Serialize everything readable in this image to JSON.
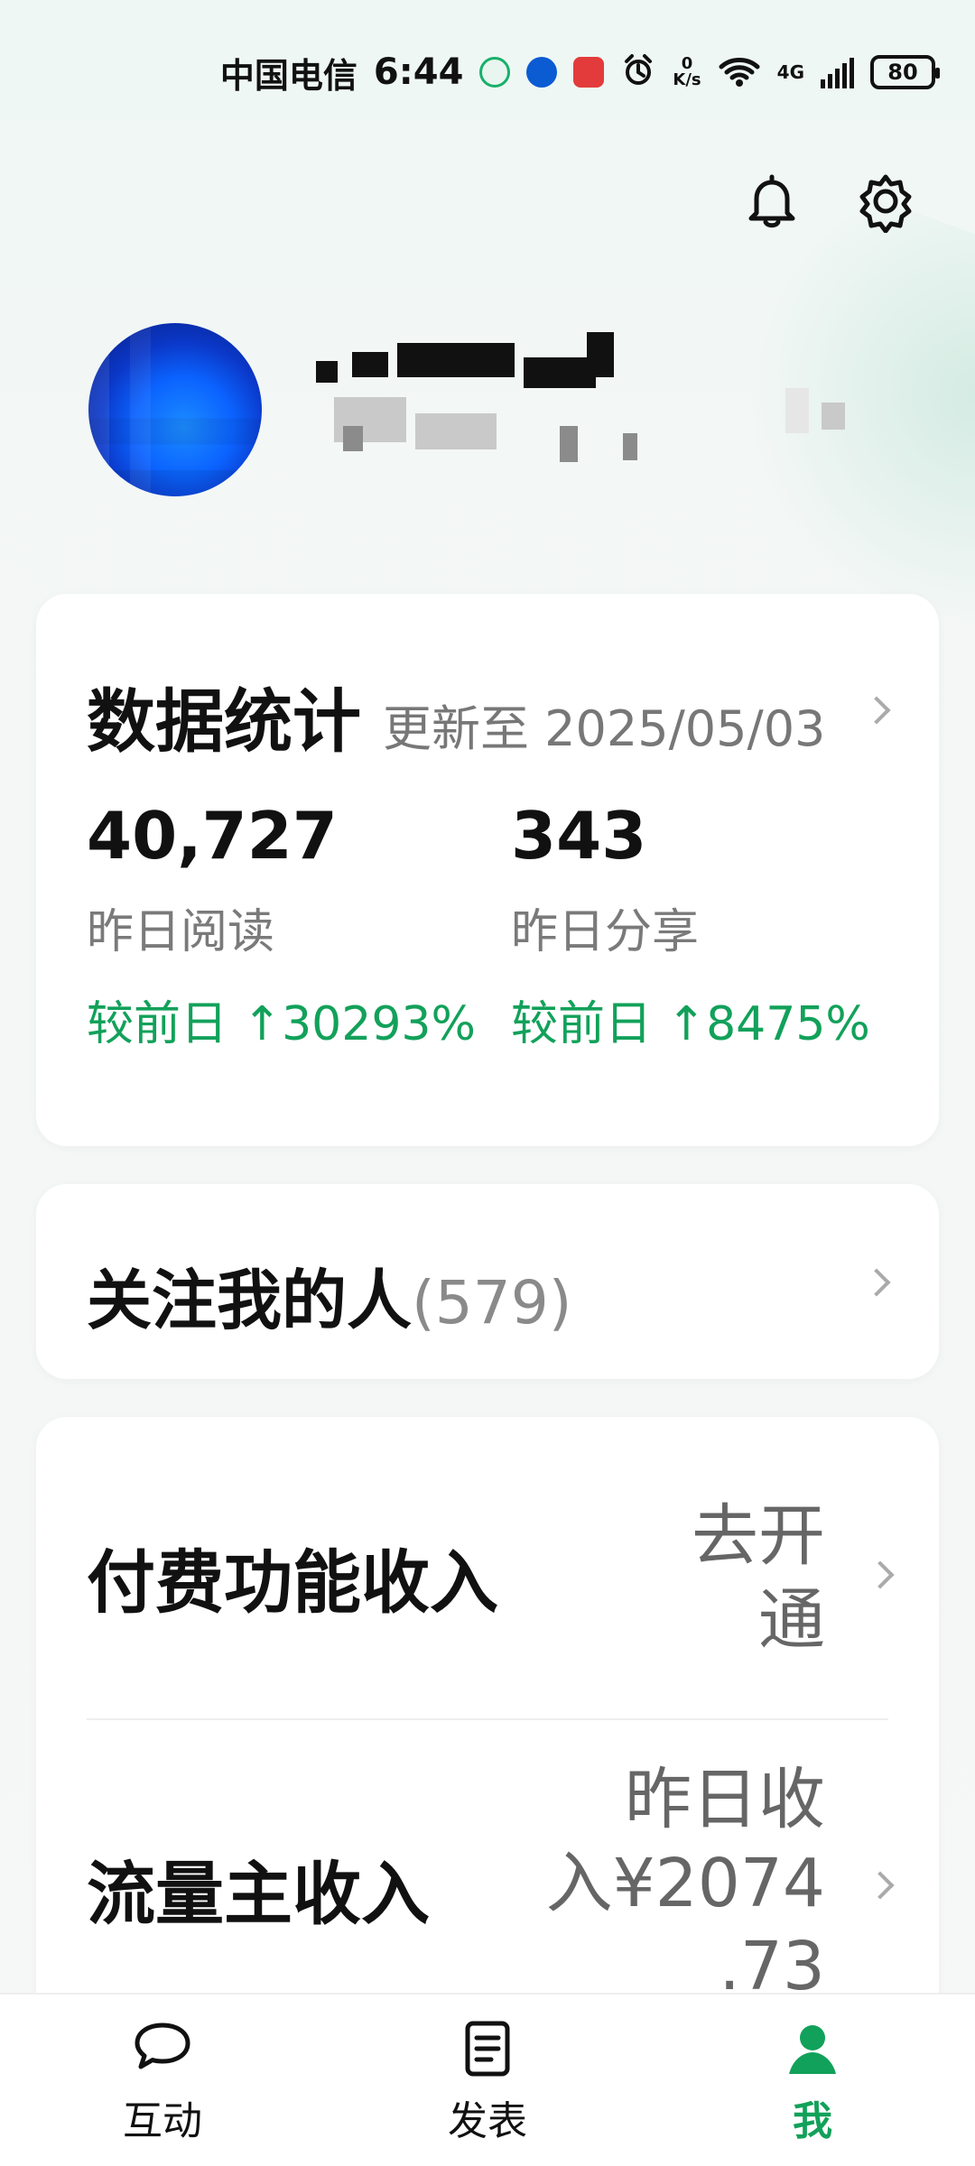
{
  "status_bar": {
    "carrier": "中国电信",
    "time": "6:44",
    "net_speed_value": "0",
    "net_speed_unit": "K/s",
    "network": "4G",
    "battery": "80"
  },
  "header": {
    "icons": [
      "bell-icon",
      "settings-icon"
    ]
  },
  "stats": {
    "title": "数据统计",
    "updated": "更新至 2025/05/03",
    "items": [
      {
        "value": "40,727",
        "label": "昨日阅读",
        "change": "较前日 ↑30293%"
      },
      {
        "value": "343",
        "label": "昨日分享",
        "change": "较前日 ↑8475%"
      }
    ]
  },
  "followers": {
    "title": "关注我的人",
    "count": "(579)"
  },
  "income": {
    "paid_title": "付费功能收入",
    "paid_value_line1": "去开",
    "paid_value_line2": "通",
    "traffic_title": "流量主收入",
    "traffic_value_line1": "昨日收",
    "traffic_value_line2": "入¥2074",
    "traffic_value_line3": ".73"
  },
  "nav": {
    "items": [
      {
        "label": "互动",
        "icon": "chat-bubble-icon"
      },
      {
        "label": "发表",
        "icon": "document-icon"
      },
      {
        "label": "我",
        "icon": "user-icon"
      }
    ]
  },
  "colors": {
    "accent_green": "#12a15a"
  }
}
